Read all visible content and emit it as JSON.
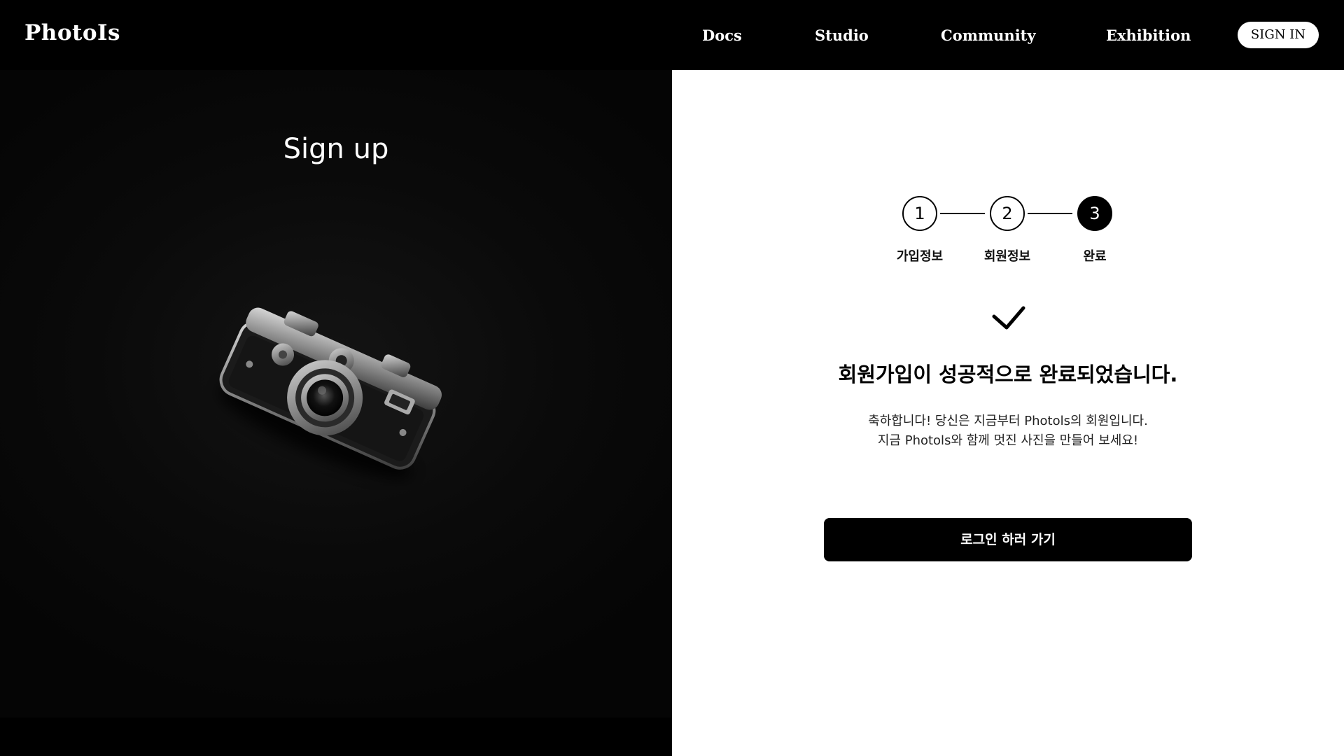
{
  "header": {
    "brand": "PhotoIs",
    "nav": [
      "Docs",
      "Studio",
      "Community",
      "Exhibition"
    ],
    "signin_label": "SIGN IN"
  },
  "hero": {
    "title": "Sign up"
  },
  "stepper": {
    "steps": [
      {
        "number": "1",
        "label": "가입정보"
      },
      {
        "number": "2",
        "label": "회원정보"
      },
      {
        "number": "3",
        "label": "완료"
      }
    ],
    "current_step": 3
  },
  "success": {
    "icon": "check-icon",
    "title": "회원가입이 성공적으로 완료되었습니다.",
    "message_line1": "축하합니다! 당신은 지금부터 Photols의 회원입니다.",
    "message_line2": "지금 Photols와 함께 멋진 사진을 만들어 보세요!",
    "button_label": "로그인 하러 가기"
  },
  "colors": {
    "primary": "#000000",
    "background": "#ffffff"
  }
}
